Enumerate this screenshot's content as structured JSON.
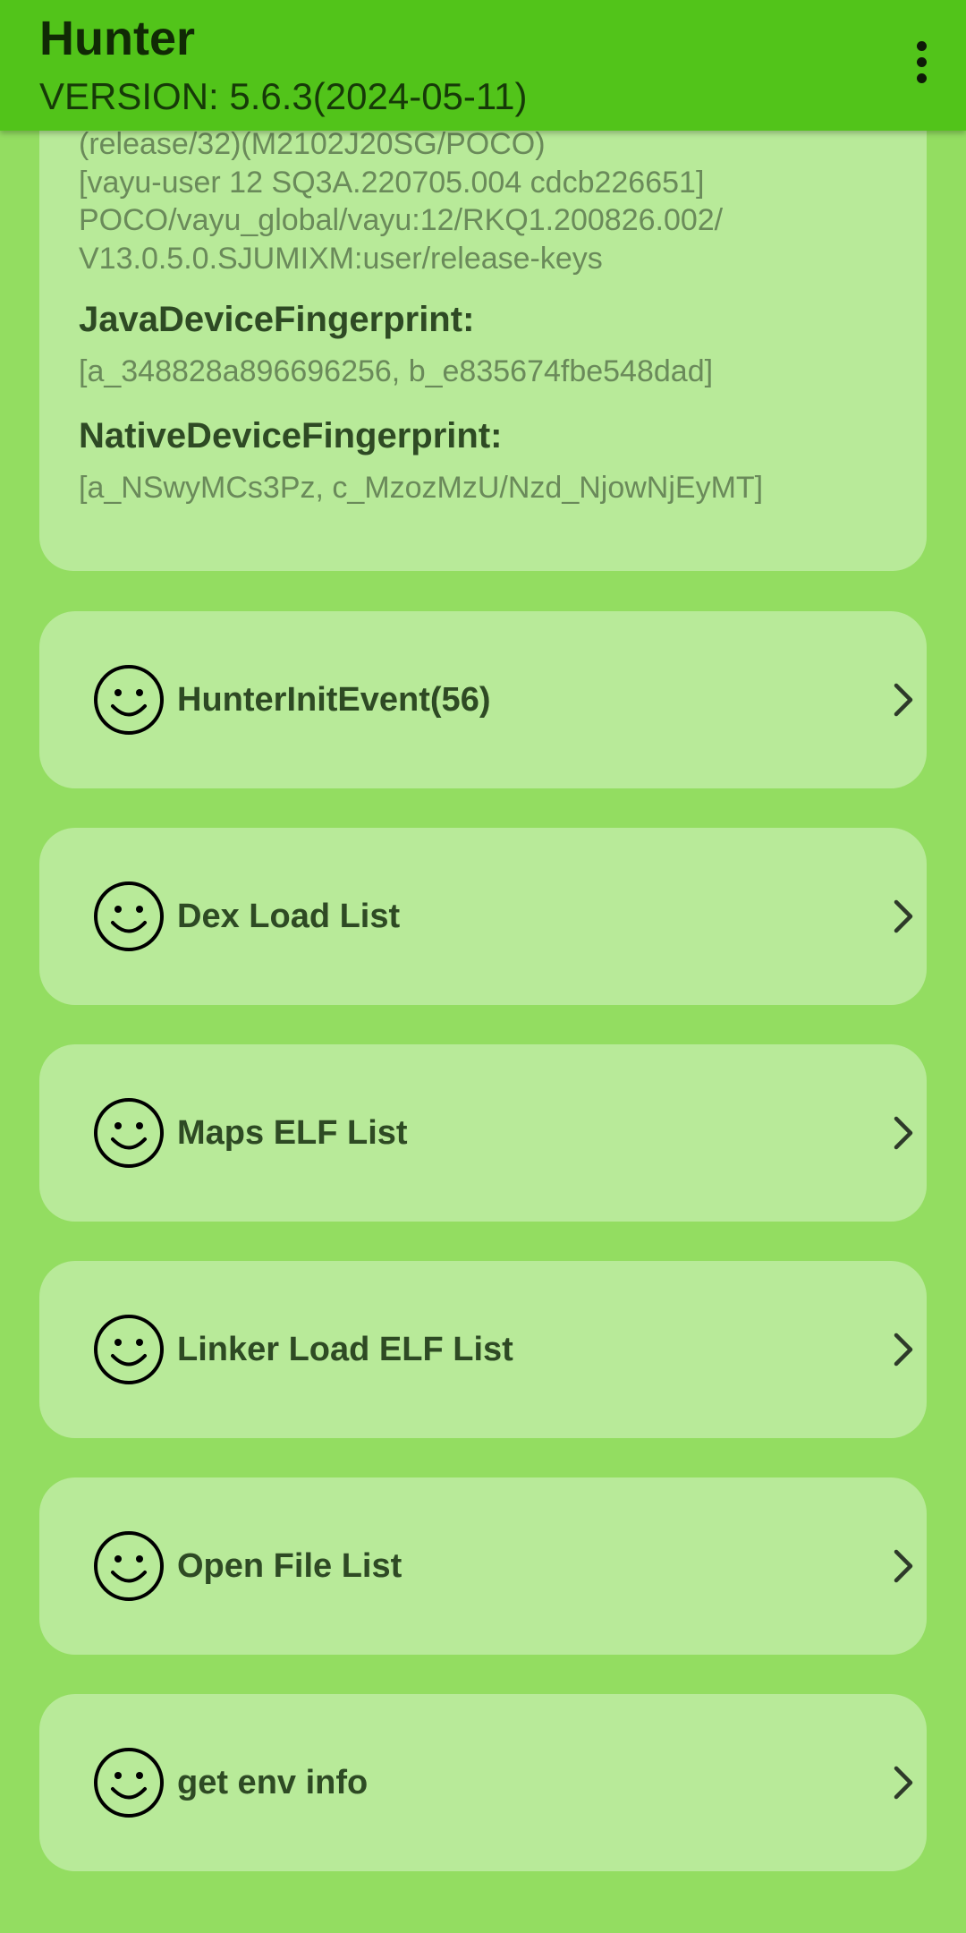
{
  "app": {
    "title": "Hunter",
    "version": "VERSION: 5.6.3(2024-05-11)",
    "menu_icon": "more-vert-icon"
  },
  "info_card": {
    "build_lines": [
      "(release/32)(M2102J20SG/POCO)",
      "[vayu-user 12 SQ3A.220705.004 cdcb226651]",
      "POCO/vayu_global/vayu:12/RKQ1.200826.002/",
      "V13.0.5.0.SJUMIXM:user/release-keys"
    ],
    "java_label": "JavaDeviceFingerprint:",
    "java_value": "[a_348828a896696256, b_e835674fbe548dad]",
    "native_label": "NativeDeviceFingerprint:",
    "native_value": "[a_NSwyMCs3Pz, c_MzozMzU/Nzd_NjowNjEyMT]"
  },
  "items": [
    {
      "icon": "smiley-icon",
      "label": "HunterInitEvent(56)"
    },
    {
      "icon": "smiley-icon",
      "label": "Dex Load List"
    },
    {
      "icon": "smiley-icon",
      "label": "Maps ELF List"
    },
    {
      "icon": "smiley-icon",
      "label": "Linker Load ELF List"
    },
    {
      "icon": "smiley-icon",
      "label": "Open File List"
    },
    {
      "icon": "smiley-icon",
      "label": "get env info"
    }
  ],
  "colors": {
    "app_bar": "#52c41a",
    "background": "#93dd61",
    "card": "#b8ea99",
    "label_text": "#2e4a24",
    "muted_text": "#6a8a5a"
  }
}
